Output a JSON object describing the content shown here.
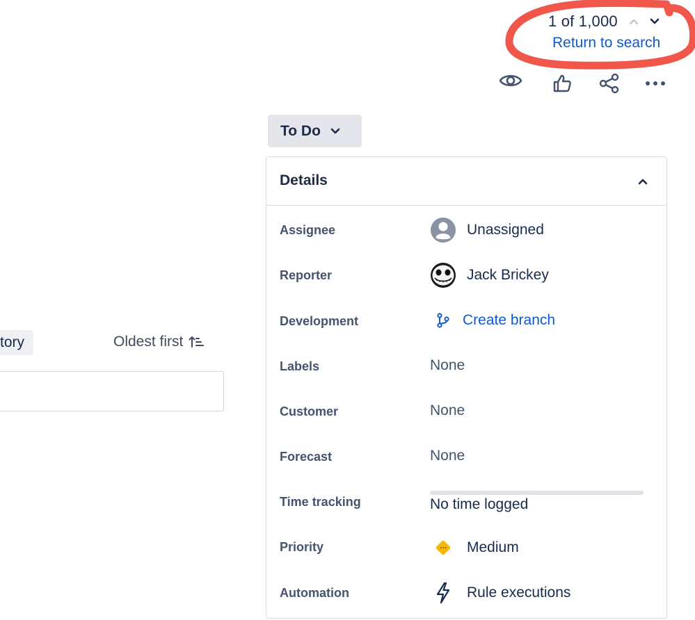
{
  "pager": {
    "count_text": "1 of 1,000",
    "return_label": "Return to search"
  },
  "status": {
    "label": "To Do"
  },
  "activity": {
    "history_tab_label": "tory",
    "sort_label": "Oldest first"
  },
  "details": {
    "title": "Details",
    "fields": {
      "assignee": {
        "label": "Assignee",
        "value": "Unassigned",
        "icon": "user-placeholder-icon"
      },
      "reporter": {
        "label": "Reporter",
        "value": "Jack Brickey",
        "icon": "avatar-skull"
      },
      "development": {
        "label": "Development",
        "value": "Create branch",
        "icon": "branch-icon"
      },
      "labels": {
        "label": "Labels",
        "value": "None"
      },
      "customer": {
        "label": "Customer",
        "value": "None"
      },
      "forecast": {
        "label": "Forecast",
        "value": "None"
      },
      "time_tracking": {
        "label": "Time tracking",
        "value": "No time logged",
        "progress": 0
      },
      "priority": {
        "label": "Priority",
        "value": "Medium",
        "icon": "priority-medium-icon"
      },
      "automation": {
        "label": "Automation",
        "value": "Rule executions",
        "icon": "lightning-icon"
      }
    }
  },
  "colors": {
    "link": "#0c5bd0",
    "annotation": "#f0564a",
    "priority_medium": "#f5b90b"
  }
}
